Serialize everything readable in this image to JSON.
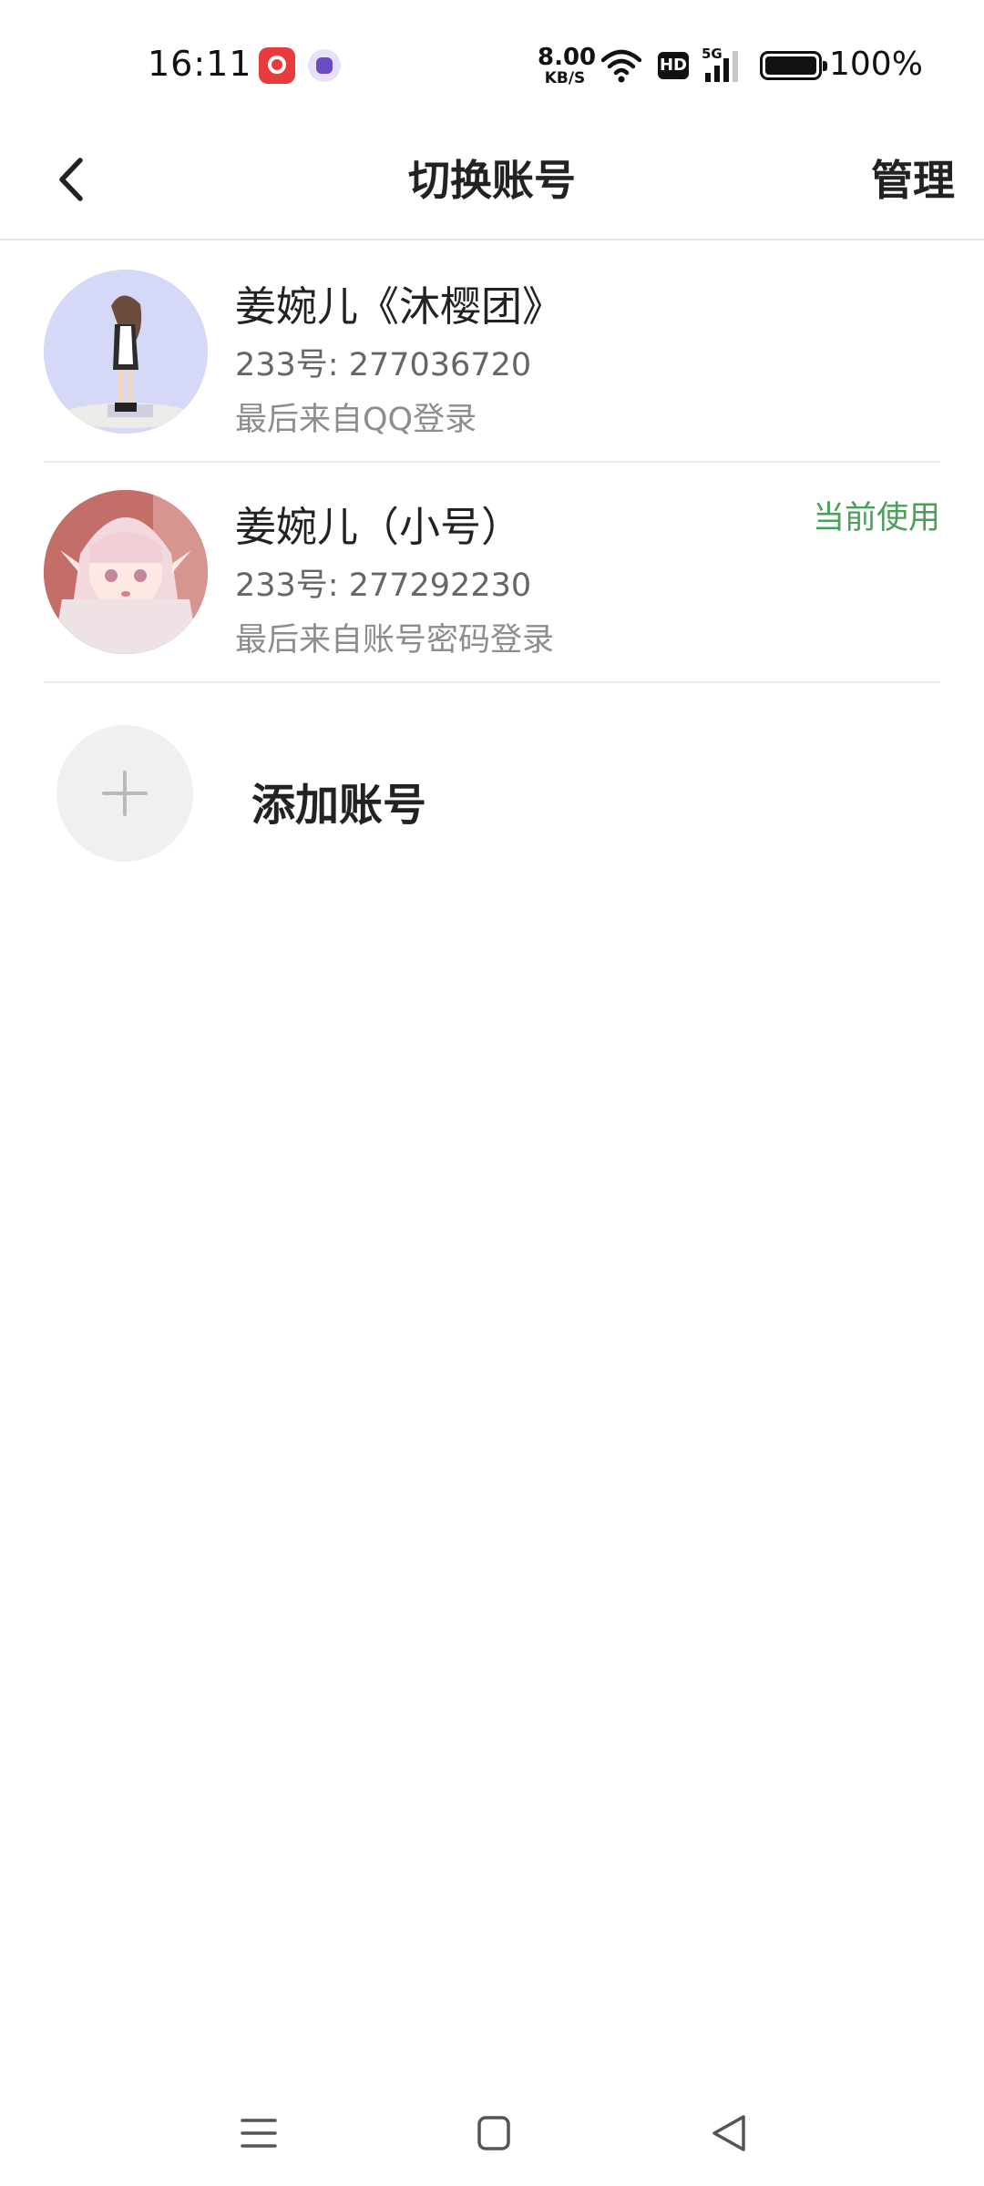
{
  "status_bar": {
    "time": "16:11",
    "net_speed_value": "8.00",
    "net_speed_unit": "KB/S",
    "hd_label": "HD",
    "network_type": "5G",
    "battery_percent": "100%",
    "battery_level": 1.0
  },
  "header": {
    "title": "切换账号",
    "manage_label": "管理"
  },
  "accounts": [
    {
      "name": "姜婉儿《沐樱团》",
      "id_text": "233号: 277036720",
      "login_text": "最后来自QQ登录",
      "current_label": ""
    },
    {
      "name": "姜婉儿（小号）",
      "id_text": "233号: 277292230",
      "login_text": "最后来自账号密码登录",
      "current_label": "当前使用"
    }
  ],
  "add_account": {
    "label": "添加账号"
  },
  "colors": {
    "accent_green": "#4a9f5a",
    "divider": "#ececec",
    "text_primary": "#222222",
    "text_secondary": "#666666"
  },
  "icons": {
    "back": "chevron-left-icon",
    "add": "plus-icon",
    "nav_menu": "menu-icon",
    "nav_home": "home-square-icon",
    "nav_back": "triangle-back-icon"
  }
}
